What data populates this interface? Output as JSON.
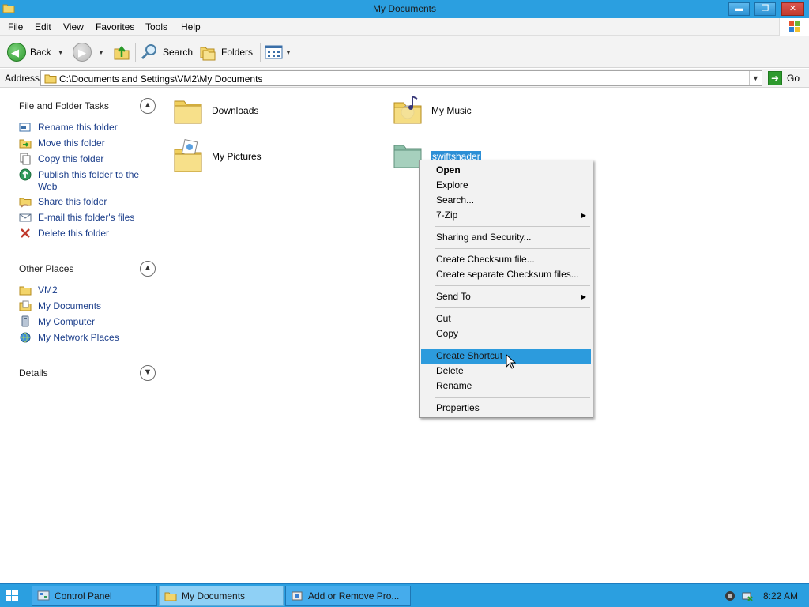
{
  "window": {
    "title": "My Documents",
    "minimize_glyph": "▬",
    "restore_glyph": "❐",
    "close_glyph": "✕"
  },
  "menubar": {
    "items": [
      "File",
      "Edit",
      "View",
      "Favorites",
      "Tools",
      "Help"
    ]
  },
  "toolbar": {
    "back_label": "Back",
    "search_label": "Search",
    "folders_label": "Folders",
    "views_icon": "views-icon"
  },
  "address": {
    "label": "Address",
    "value": "C:\\Documents and Settings\\VM2\\My Documents",
    "go_label": "Go"
  },
  "taskpane": {
    "file_folder_tasks": {
      "heading": "File and Folder Tasks",
      "items": [
        {
          "label": "Rename this folder",
          "icon": "rename-icon"
        },
        {
          "label": "Move this folder",
          "icon": "move-icon"
        },
        {
          "label": "Copy this folder",
          "icon": "copy-icon"
        },
        {
          "label": "Publish this folder to the Web",
          "icon": "publish-web-icon"
        },
        {
          "label": "Share this folder",
          "icon": "share-icon"
        },
        {
          "label": "E-mail this folder's files",
          "icon": "email-icon"
        },
        {
          "label": "Delete this folder",
          "icon": "delete-icon"
        }
      ]
    },
    "other_places": {
      "heading": "Other Places",
      "items": [
        {
          "label": "VM2",
          "icon": "folder-icon"
        },
        {
          "label": "My Documents",
          "icon": "my-documents-icon"
        },
        {
          "label": "My Computer",
          "icon": "my-computer-icon"
        },
        {
          "label": "My Network Places",
          "icon": "network-places-icon"
        }
      ]
    },
    "details": {
      "heading": "Details"
    }
  },
  "content": {
    "folders": [
      {
        "label": "Downloads",
        "icon": "folder-icon"
      },
      {
        "label": "My Music",
        "icon": "music-folder-icon"
      },
      {
        "label": "My Pictures",
        "icon": "pictures-folder-icon"
      },
      {
        "label": "swiftshader",
        "icon": "folder-icon",
        "selected": true
      }
    ]
  },
  "context_menu": {
    "groups": [
      [
        {
          "label": "Open",
          "bold": true
        },
        {
          "label": "Explore"
        },
        {
          "label": "Search..."
        },
        {
          "label": "7-Zip",
          "submenu": true
        }
      ],
      [
        {
          "label": "Sharing and Security..."
        }
      ],
      [
        {
          "label": "Create Checksum file..."
        },
        {
          "label": "Create separate Checksum files..."
        }
      ],
      [
        {
          "label": "Send To",
          "submenu": true
        }
      ],
      [
        {
          "label": "Cut"
        },
        {
          "label": "Copy"
        }
      ],
      [
        {
          "label": "Create Shortcut",
          "highlighted": true
        },
        {
          "label": "Delete"
        },
        {
          "label": "Rename"
        }
      ],
      [
        {
          "label": "Properties"
        }
      ]
    ]
  },
  "taskbar": {
    "buttons": [
      {
        "label": "Control Panel",
        "icon": "control-panel-icon"
      },
      {
        "label": "My Documents",
        "icon": "folder-icon",
        "active": true
      },
      {
        "label": "Add or Remove Pro...",
        "icon": "add-remove-programs-icon"
      }
    ],
    "clock": "8:22 AM"
  },
  "colors": {
    "titlebar": "#2b9fe0",
    "selection": "#2c9bdd",
    "link": "#1a3d8a"
  }
}
